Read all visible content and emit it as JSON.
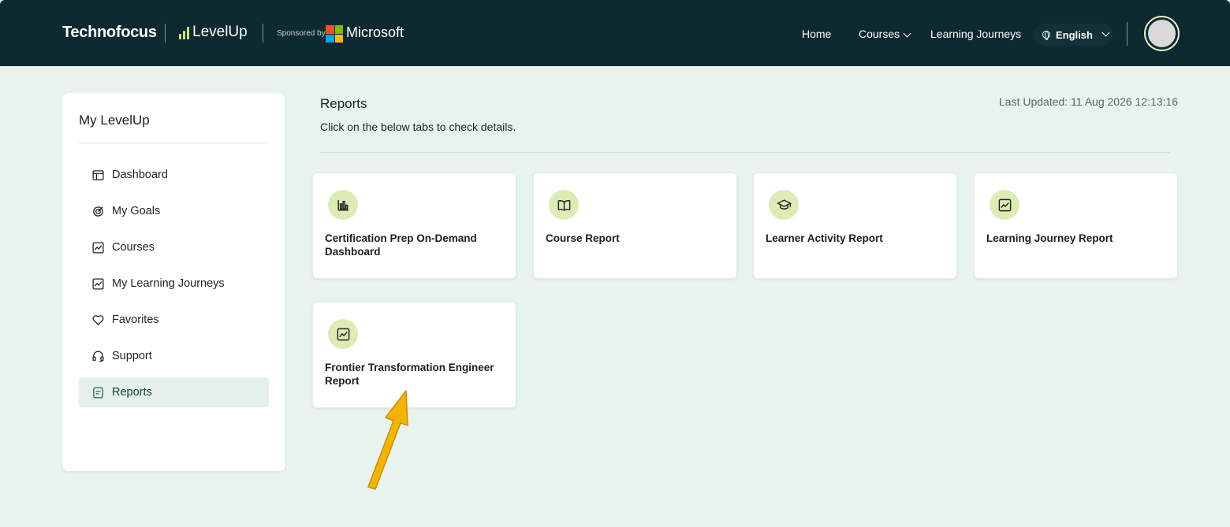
{
  "header": {
    "brand": "Technofocus",
    "product": "LevelUp",
    "sponsored_by": "Sponsored by",
    "sponsor_name": "Microsoft",
    "nav": {
      "home": "Home",
      "courses": "Courses",
      "learning_journeys": "Learning Journeys"
    },
    "language": "English"
  },
  "sidebar": {
    "title": "My LevelUp",
    "items": [
      {
        "label": "Dashboard",
        "icon": "dashboard-icon",
        "active": false
      },
      {
        "label": "My Goals",
        "icon": "goals-icon",
        "active": false
      },
      {
        "label": "Courses",
        "icon": "courses-icon",
        "active": false
      },
      {
        "label": "My Learning Journeys",
        "icon": "journey-icon",
        "active": false
      },
      {
        "label": "Favorites",
        "icon": "heart-icon",
        "active": false
      },
      {
        "label": "Support",
        "icon": "headset-icon",
        "active": false
      },
      {
        "label": "Reports",
        "icon": "reports-icon",
        "active": true
      }
    ]
  },
  "main": {
    "title": "Reports",
    "subtitle": "Click on the below tabs to check details.",
    "last_updated": "Last Updated: 11 Aug 2026 12:13:16",
    "cards": [
      {
        "label": "Certification Prep On-Demand Dashboard",
        "icon": "bar-chart-icon"
      },
      {
        "label": "Course Report",
        "icon": "book-icon"
      },
      {
        "label": "Learner Activity Report",
        "icon": "graduation-cap-icon"
      },
      {
        "label": "Learning Journey Report",
        "icon": "trend-chart-icon"
      },
      {
        "label": "Frontier Transformation Engineer Report",
        "icon": "trend-chart-icon"
      }
    ]
  },
  "colors": {
    "header_bg": "#0d2a30",
    "page_bg": "#e8f3ee",
    "icon_bg": "#dcecb4",
    "active_item_bg": "#e5f0ea",
    "annotation_arrow": "#f5b400"
  }
}
